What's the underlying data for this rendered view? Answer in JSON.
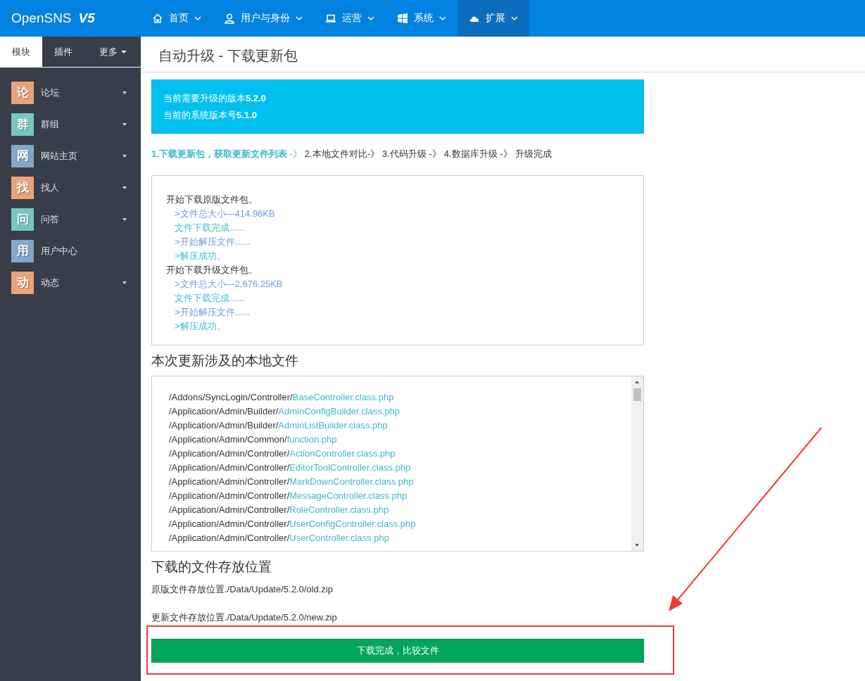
{
  "header": {
    "logo": "OpenSNS",
    "logo_version": "V5",
    "nav": [
      {
        "label": "首页",
        "selected": false
      },
      {
        "label": "用户与身份",
        "selected": false
      },
      {
        "label": "运营",
        "selected": false
      },
      {
        "label": "系统",
        "selected": false
      },
      {
        "label": "扩展",
        "selected": true
      }
    ]
  },
  "sidebar": {
    "tabs": [
      {
        "label": "模块",
        "selected": true,
        "dropdown": false
      },
      {
        "label": "插件",
        "selected": false,
        "dropdown": false
      },
      {
        "label": "更多",
        "selected": false,
        "dropdown": true
      }
    ],
    "items": [
      {
        "badge": "论",
        "label": "论坛",
        "color": "#e9a37a",
        "expandable": true
      },
      {
        "badge": "群",
        "label": "群组",
        "color": "#76c8be",
        "expandable": true
      },
      {
        "badge": "网",
        "label": "网站主页",
        "color": "#82a8c8",
        "expandable": true
      },
      {
        "badge": "找",
        "label": "找人",
        "color": "#e9a37a",
        "expandable": true
      },
      {
        "badge": "问",
        "label": "问答",
        "color": "#76c8be",
        "expandable": true
      },
      {
        "badge": "用",
        "label": "用户中心",
        "color": "#82a8c8",
        "expandable": false
      },
      {
        "badge": "动",
        "label": "动态",
        "color": "#e9a37a",
        "expandable": true
      }
    ]
  },
  "page_title": "自动升级 - 下载更新包",
  "info_box": [
    "当前需要升级的版本**5.2.0**",
    "当前的系统版本号**5.1.0**"
  ],
  "steps": [
    {
      "label": "1.下载更新包，获取更新文件列表",
      "separator": " -》",
      "selected": true
    },
    {
      "label": "2.本地文件对比",
      "separator": "-》",
      "selected": false
    },
    {
      "label": "3.代码升级",
      "separator": " -》",
      "selected": false
    },
    {
      "label": "4.数据库升级",
      "separator": " -》",
      "selected": false
    },
    {
      "label": "升级完成",
      "selected": false
    }
  ],
  "download_log": [
    {
      "text": "开始下载原版文件包。",
      "children": [
        {
          "kind": "detail",
          "text": ">文件总大小—414.96KB"
        },
        {
          "kind": "done",
          "text": "文件下载完成......"
        },
        {
          "kind": "detail",
          "text": ">开始解压文件......"
        },
        {
          "kind": "done",
          "text": ">解压成功。"
        }
      ]
    },
    {
      "text": "开始下载升级文件包。",
      "children": [
        {
          "kind": "detail",
          "text": ">文件总大小—2,676.25KB"
        },
        {
          "kind": "done",
          "text": "文件下载完成......"
        },
        {
          "kind": "detail",
          "text": ">开始解压文件......"
        },
        {
          "kind": "done",
          "text": ">解压成功。"
        }
      ]
    }
  ],
  "files_heading": "本次更新涉及的本地文件",
  "files": [
    {
      "dir": "/Addons/SyncLogin/Controller/",
      "file": "BaseController.class.php"
    },
    {
      "dir": "/Application/Admin/Builder/",
      "file": "AdminConfigBuilder.class.php"
    },
    {
      "dir": "/Application/Admin/Builder/",
      "file": "AdminListBuilder.class.php"
    },
    {
      "dir": "/Application/Admin/Common/",
      "file": "function.php"
    },
    {
      "dir": "/Application/Admin/Controller/",
      "file": "ActionController.class.php"
    },
    {
      "dir": "/Application/Admin/Controller/",
      "file": "EditorToolController.class.php"
    },
    {
      "dir": "/Application/Admin/Controller/",
      "file": "MarkDownController.class.php"
    },
    {
      "dir": "/Application/Admin/Controller/",
      "file": "MessageController.class.php"
    },
    {
      "dir": "/Application/Admin/Controller/",
      "file": "RoleController.class.php"
    },
    {
      "dir": "/Application/Admin/Controller/",
      "file": "UserConfigController.class.php"
    },
    {
      "dir": "/Application/Admin/Controller/",
      "file": "UserController.class.php"
    }
  ],
  "storage_heading": "下载的文件存放位置",
  "storage_paths": [
    "原版文件存放位置./Data/Update/5.2.0/old.zip",
    "更新文件存放位置./Data/Update/5.2.0/new.zip"
  ],
  "action_button": "下载完成，比较文件"
}
